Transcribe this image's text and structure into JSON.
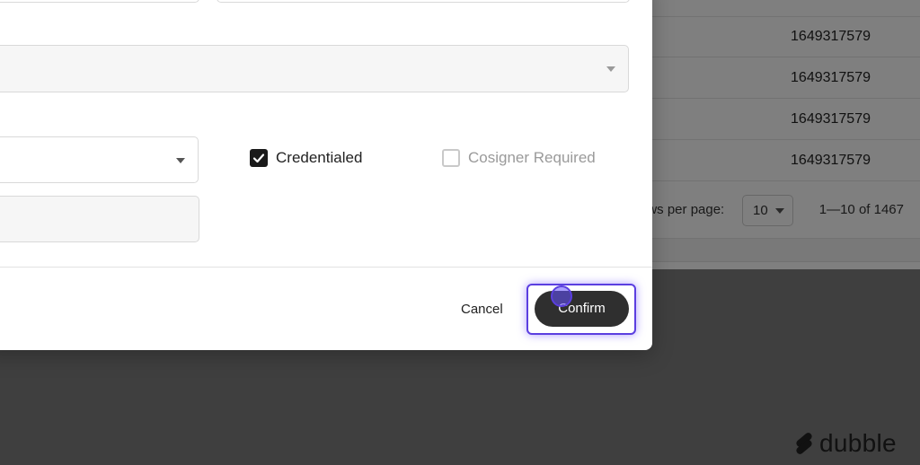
{
  "background_table": {
    "rows": [
      "1649317579",
      "1649317579",
      "1649317579",
      "1649317579"
    ],
    "pagination": {
      "rows_per_page_label": "ows per page:",
      "rows_per_page_value": "10",
      "range_text": "1—10 of 1467"
    }
  },
  "modal": {
    "checkboxes": [
      {
        "label": "Credentialed",
        "checked": true
      },
      {
        "label": "Cosigner Required",
        "checked": false,
        "disabled": true
      }
    ],
    "footer": {
      "cancel_label": "Cancel",
      "confirm_label": "Confirm"
    }
  },
  "brand": {
    "name": "dubble",
    "icon": "dubble-logo-icon"
  }
}
